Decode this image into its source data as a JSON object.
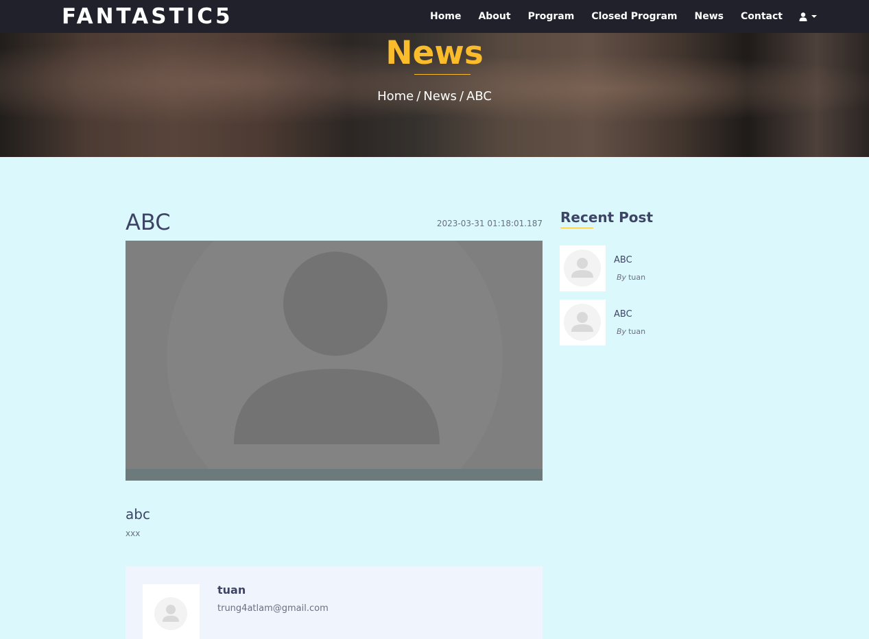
{
  "navbar": {
    "brand": "FANTASTIC5",
    "links": [
      "Home",
      "About",
      "Program",
      "Closed Program",
      "News",
      "Contact"
    ],
    "user_icon": "user-icon"
  },
  "hero": {
    "title": "News",
    "breadcrumb": [
      "Home",
      "News",
      "ABC"
    ],
    "separator": "/"
  },
  "post": {
    "title": "ABC",
    "date": "2023-03-31 01:18:01.187",
    "image_icon": "avatar-placeholder-icon",
    "subtitle": "abc",
    "body": "xxx"
  },
  "author": {
    "name": "tuan",
    "email": "trung4atlam@gmail.com"
  },
  "sidebar": {
    "title": "Recent Post",
    "items": [
      {
        "title": "ABC",
        "by_label": "By",
        "author": "tuan"
      },
      {
        "title": "ABC",
        "by_label": "By",
        "author": "tuan"
      }
    ]
  },
  "colors": {
    "navbar_bg": "#21212b",
    "accent": "#fbbc2c",
    "page_bg": "#dbf9fc",
    "heading": "#3e4466"
  }
}
